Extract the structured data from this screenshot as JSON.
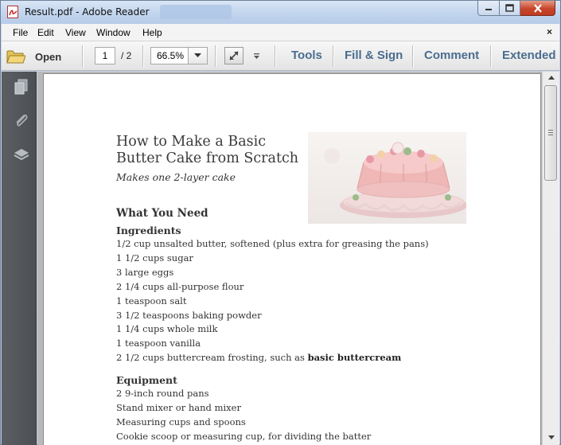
{
  "window": {
    "title": "Result.pdf - Adobe Reader"
  },
  "menu": {
    "items": [
      "File",
      "Edit",
      "View",
      "Window",
      "Help"
    ],
    "close_glyph": "×"
  },
  "toolbar": {
    "open_label": "Open",
    "page_current": "1",
    "page_total": "/ 2",
    "zoom": "66.5%",
    "links": [
      "Tools",
      "Fill & Sign",
      "Comment",
      "Extended"
    ]
  },
  "document": {
    "title": "How to Make a Basic Butter Cake from Scratch",
    "subtitle": "Makes one 2-layer cake",
    "section_heading": "What You Need",
    "ingredients_heading": "Ingredients",
    "ingredients": [
      "1/2 cup unsalted butter, softened (plus extra for greasing the pans)",
      "1 1/2 cups sugar",
      "3 large eggs",
      "2 1/4 cups all-purpose flour",
      "1 teaspoon salt",
      "3 1/2 teaspoons baking powder",
      "1 1/4 cups whole milk",
      "1 teaspoon vanilla"
    ],
    "frosting_prefix": "2 1/2 cups buttercream frosting, such as ",
    "frosting_link": "basic buttercream",
    "equipment_heading": "Equipment",
    "equipment": [
      "2 9-inch round pans",
      "Stand mixer or hand mixer",
      "Measuring cups and spoons",
      "Cookie scoop or measuring cup, for dividing the batter"
    ]
  },
  "colors": {
    "toolbar_link": "#4a6d8f",
    "nav_pane": "#505357",
    "close_button": "#c8462c"
  },
  "icons": {
    "app": "pdf-document-icon",
    "open": "folder-icon",
    "nav": [
      "pages-icon",
      "attachment-icon",
      "layers-icon"
    ]
  }
}
